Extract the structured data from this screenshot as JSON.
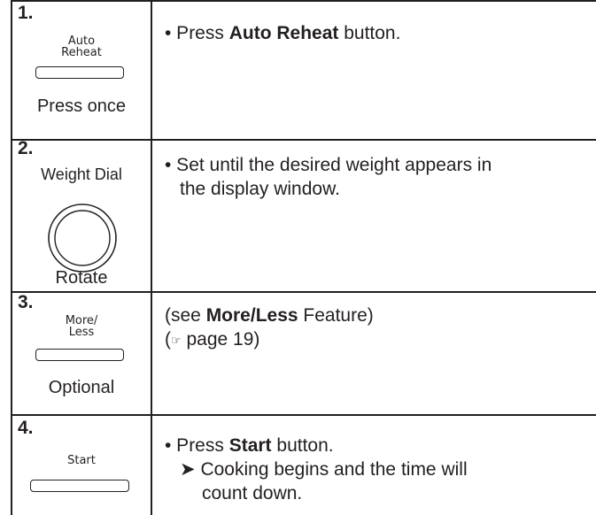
{
  "steps": [
    {
      "number": "1.",
      "button_label_line1": "Auto",
      "button_label_line2": "Reheat",
      "action": "Press once",
      "text_prefix": "• Press ",
      "text_bold": "Auto Reheat",
      "text_suffix": " button."
    },
    {
      "number": "2.",
      "control_label": "Weight Dial",
      "action": "Rotate",
      "text": "• Set until the desired weight appears in",
      "text_line2": "the display window."
    },
    {
      "number": "3.",
      "button_label_line1": "More/",
      "button_label_line2": "Less",
      "action": "Optional",
      "text_prefix": "(see ",
      "text_bold": "More/Less",
      "text_suffix": " Feature)",
      "ref_icon": "☞",
      "ref_text": " page 19)",
      "ref_open": "("
    },
    {
      "number": "4.",
      "button_label": "Start",
      "text_prefix": "• Press ",
      "text_bold": "Start",
      "text_suffix": " button.",
      "sub_arrow": "➤",
      "sub_text_line1": " Cooking begins and the time will",
      "sub_text_line2": "count down."
    }
  ]
}
